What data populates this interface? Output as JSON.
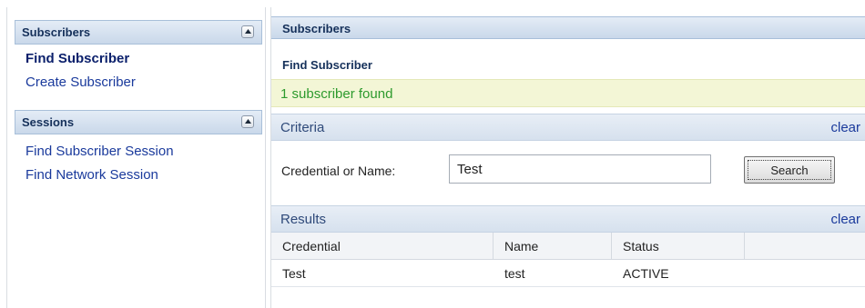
{
  "sidebar": {
    "subscribers": {
      "title": "Subscribers",
      "links": [
        "Find Subscriber",
        "Create Subscriber"
      ]
    },
    "sessions": {
      "title": "Sessions",
      "links": [
        "Find Subscriber Session",
        "Find Network Session"
      ]
    }
  },
  "main": {
    "header": "Subscribers",
    "subtitle": "Find Subscriber",
    "status_message": "1 subscriber found",
    "criteria": {
      "title": "Criteria",
      "clear_label": "clear",
      "field_label": "Credential or Name:",
      "field_value": "Test",
      "search_label": "Search"
    },
    "results": {
      "title": "Results",
      "clear_label": "clear",
      "columns": [
        "Credential",
        "Name",
        "Status",
        ""
      ],
      "rows": [
        [
          "Test",
          "test",
          "ACTIVE",
          ""
        ]
      ]
    }
  },
  "colors": {
    "panel_header": "#c9d8ea",
    "link": "#1a3a9c",
    "success_text": "#2d9a2d",
    "status_bar": "#f3f6d6"
  },
  "icons": {
    "collapse": "chevron-up-icon"
  }
}
